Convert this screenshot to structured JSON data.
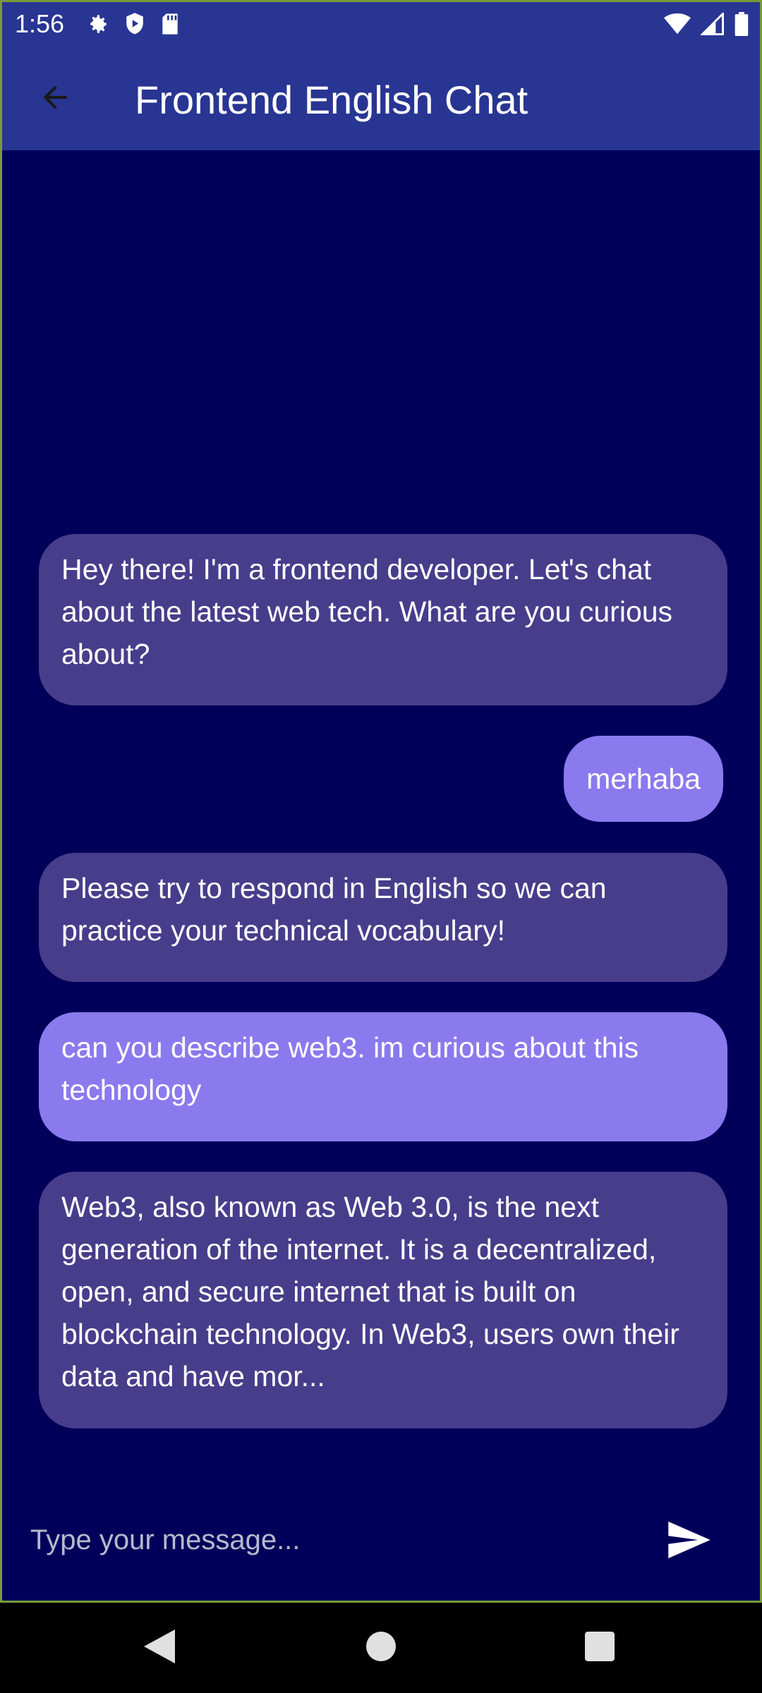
{
  "status_bar": {
    "time": "1:56",
    "left_icons": [
      "gear-icon",
      "shield-play-icon",
      "sd-card-icon"
    ],
    "right_icons": [
      "wifi-icon",
      "cellular-signal-icon",
      "battery-icon"
    ]
  },
  "app_bar": {
    "title": "Frontend English Chat",
    "back_icon": "arrow-back-icon"
  },
  "messages": [
    {
      "sender": "bot",
      "text": "Hey there! I'm a frontend developer. Let's chat about the latest web tech. What are you curious about?"
    },
    {
      "sender": "user",
      "text": "merhaba"
    },
    {
      "sender": "bot",
      "text": "Please try to respond in English so we can practice your technical vocabulary!"
    },
    {
      "sender": "user",
      "text": "can you describe web3. im curious about this technology"
    },
    {
      "sender": "bot",
      "text": "Web3, also known as Web 3.0, is the next generation of the internet. It is a decentralized, open, and secure internet that is built on blockchain technology. In Web3, users own their data and have mor..."
    }
  ],
  "composer": {
    "placeholder": "Type your message...",
    "value": "",
    "send_icon": "send-icon"
  },
  "nav_bar": {
    "buttons": [
      "back-triangle-icon",
      "home-circle-icon",
      "recents-square-icon"
    ]
  },
  "colors": {
    "app_bar": "#283593",
    "chat_background": "#00005a",
    "bot_bubble": "#483d8b",
    "user_bubble": "#8a7aee",
    "text": "#ffffff"
  }
}
